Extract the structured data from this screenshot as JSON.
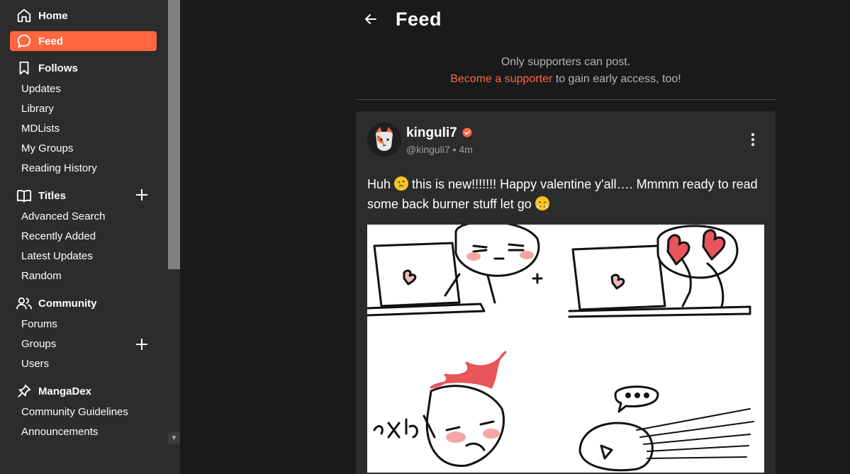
{
  "sidebar": {
    "home": "Home",
    "feed": "Feed",
    "follows": {
      "title": "Follows",
      "items": [
        "Updates",
        "Library",
        "MDLists",
        "My Groups",
        "Reading History"
      ]
    },
    "titles": {
      "title": "Titles",
      "items": [
        "Advanced Search",
        "Recently Added",
        "Latest Updates",
        "Random"
      ]
    },
    "community": {
      "title": "Community",
      "items": [
        "Forums",
        "Groups",
        "Users"
      ]
    },
    "mangadex": {
      "title": "MangaDex",
      "items": [
        "Community Guidelines",
        "Announcements"
      ]
    }
  },
  "main": {
    "title": "Feed",
    "notice_line1": "Only supporters can post.",
    "notice_link": "Become a supporter",
    "notice_rest": " to gain early access, too!"
  },
  "post": {
    "username": "kinguli7",
    "handle": "@kinguli7",
    "time": "4m",
    "text_part1": "Huh ",
    "text_part2": " this is new!!!!!!! Happy valentine y'all…. Mmmm ready to read some back burner stuff let go ",
    "emoji1": "thinking-face",
    "emoji2": "face-with-steam"
  },
  "colors": {
    "accent": "#ff6740",
    "sidebar_bg": "#2c2c2c",
    "page_bg": "#191a1c"
  }
}
